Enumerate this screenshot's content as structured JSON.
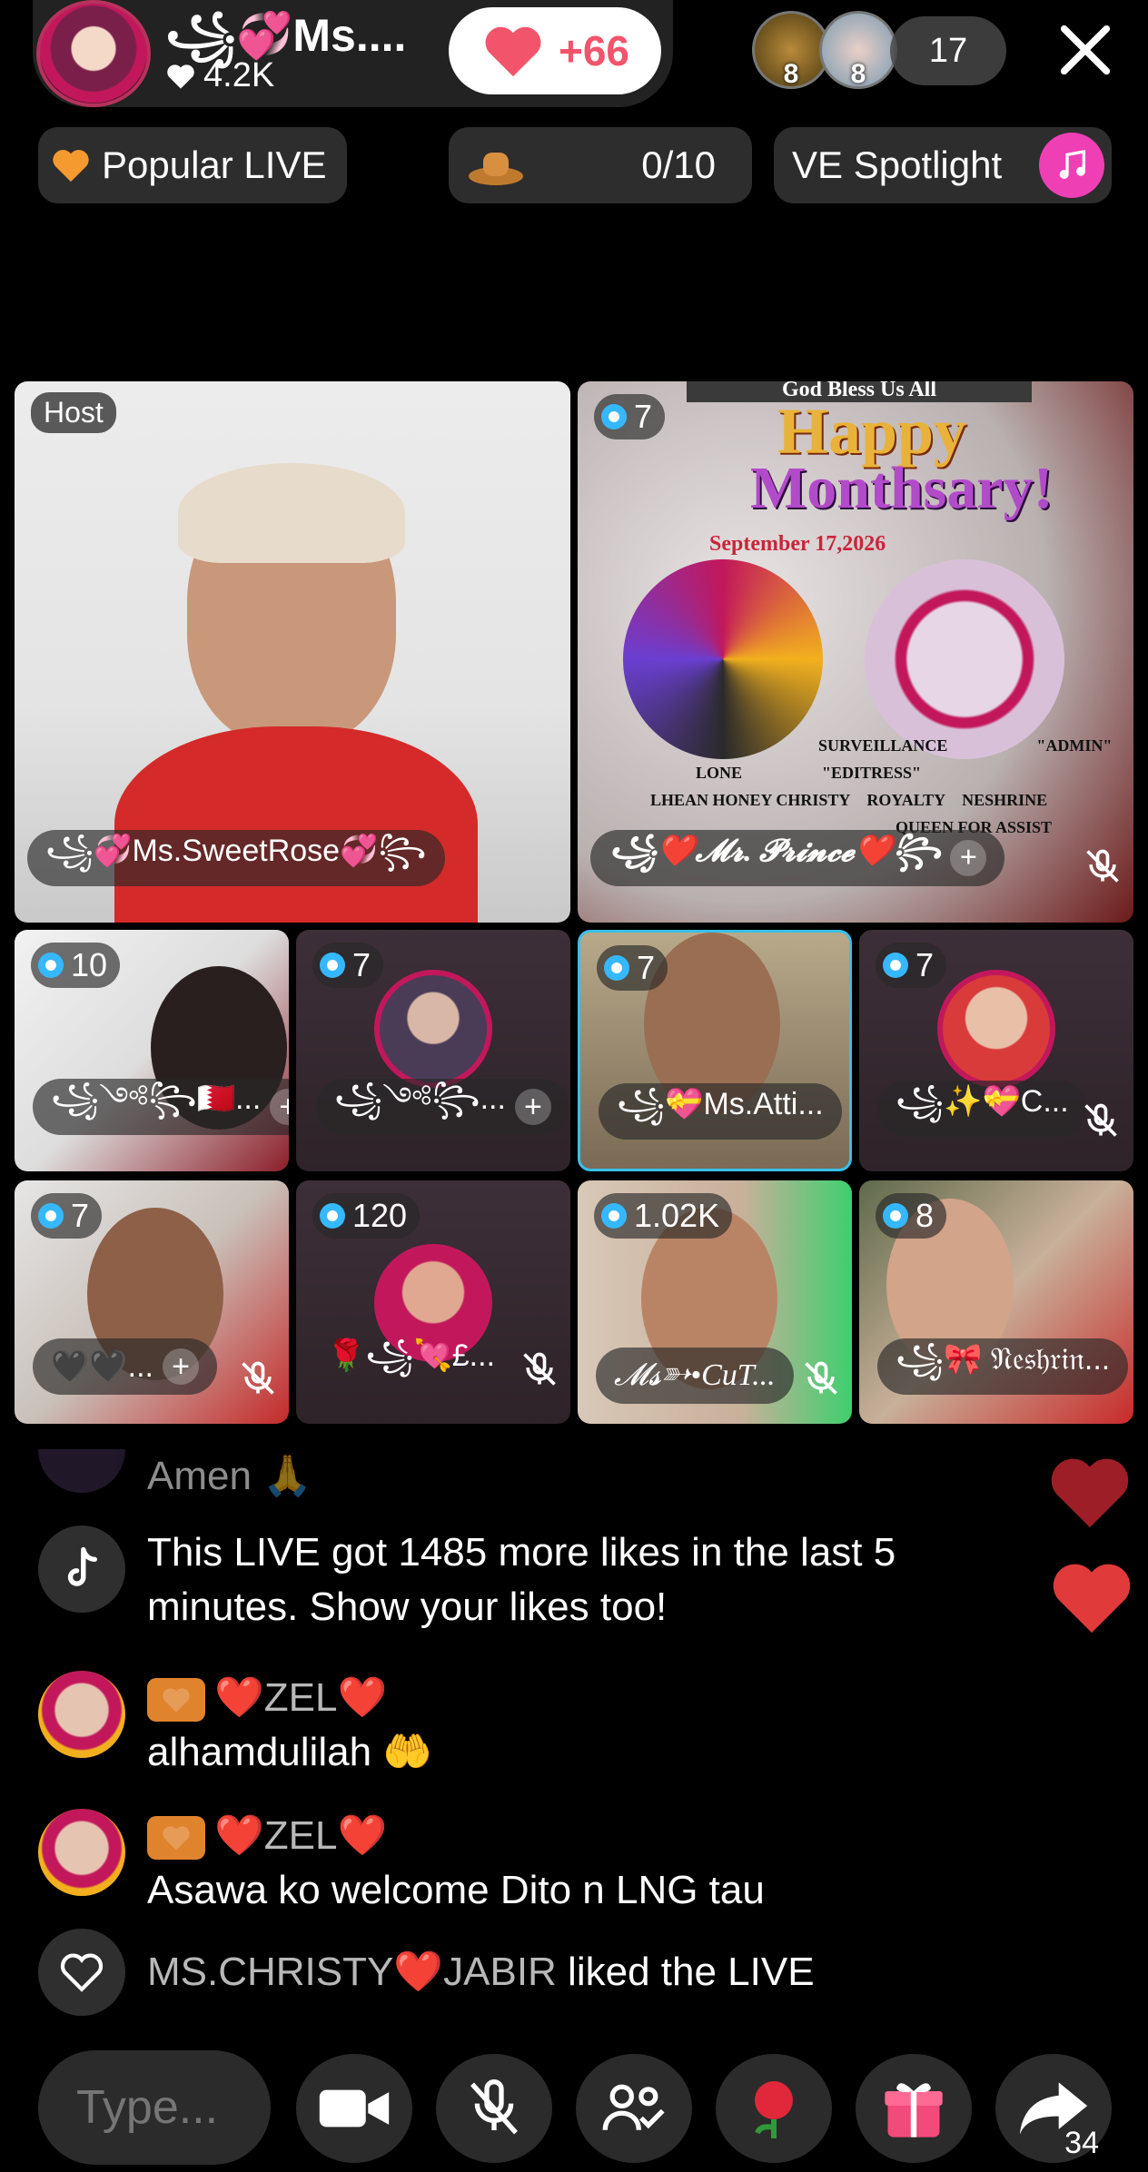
{
  "header": {
    "host_name": "꧁💞Ms....",
    "host_likes": "4.2K",
    "like_gain": "+66",
    "viewer_badges": [
      "8",
      "8"
    ],
    "viewer_count": "17",
    "close_icon": "close-icon"
  },
  "banners": {
    "popular": "Popular LIVE",
    "gift_progress": "0/10",
    "spotlight": "VE Spotlight"
  },
  "grid": {
    "host_tag": "Host",
    "tiles": [
      {
        "name": "꧁💞Ms.SweetRose💞꧂",
        "level": ""
      },
      {
        "name": "꧁❤️𝓜𝓻. 𝓟𝓻𝓲𝓷𝓬𝓮❤️꧂",
        "level": "7"
      },
      {
        "name": "꧁༺꧂🇧🇭...",
        "level": "10"
      },
      {
        "name": "꧁༺꧂...",
        "level": "7"
      },
      {
        "name": "꧁💝Ms.Atti...",
        "level": "7"
      },
      {
        "name": "꧁✨💝C...",
        "level": "7"
      },
      {
        "name": "🖤🖤...",
        "level": "7"
      },
      {
        "name": "🌹꧁💘£...",
        "level": "120"
      },
      {
        "name": "𝓜𝓼➳•CuT...",
        "level": "1.02K"
      },
      {
        "name": "꧁🎀 𝔑𝔢𝔰𝔥𝔯𝔦𝔫...",
        "level": "8"
      }
    ],
    "poster": {
      "headline": "God Bless Us All",
      "title1": "Happy",
      "title2": "Monthsary!",
      "date": "September 17,2026",
      "labels": [
        "SURVEILLANCE",
        "\"ADMIN\"",
        "LONE",
        "\"EDITRESS\"",
        "LHEAN HONEY CHRISTY",
        "ROYALTY",
        "NESHRINE",
        "QUEEN FOR ASSIST"
      ]
    }
  },
  "chat": {
    "messages": [
      {
        "text": "Amen 🙏",
        "type": "faded"
      },
      {
        "text": "This LIVE got 1485 more likes in the last 5 minutes. Show your likes too!",
        "type": "system"
      },
      {
        "user": "❤️ZEL❤️",
        "text": "alhamdulilah 🤲",
        "type": "user"
      },
      {
        "user": "❤️ZEL❤️",
        "text": "Asawa ko welcome Dito n LNG tau",
        "type": "user"
      },
      {
        "user": "MS.CHRISTY❤️JABIR",
        "text": " liked the LIVE",
        "type": "like"
      }
    ]
  },
  "bottom": {
    "comment_placeholder": "Type...",
    "share_count": "34"
  },
  "colors": {
    "accent_red": "#f2546b",
    "spotlight_pink": "#ef3fb5",
    "tag_orange": "#e0832d"
  }
}
